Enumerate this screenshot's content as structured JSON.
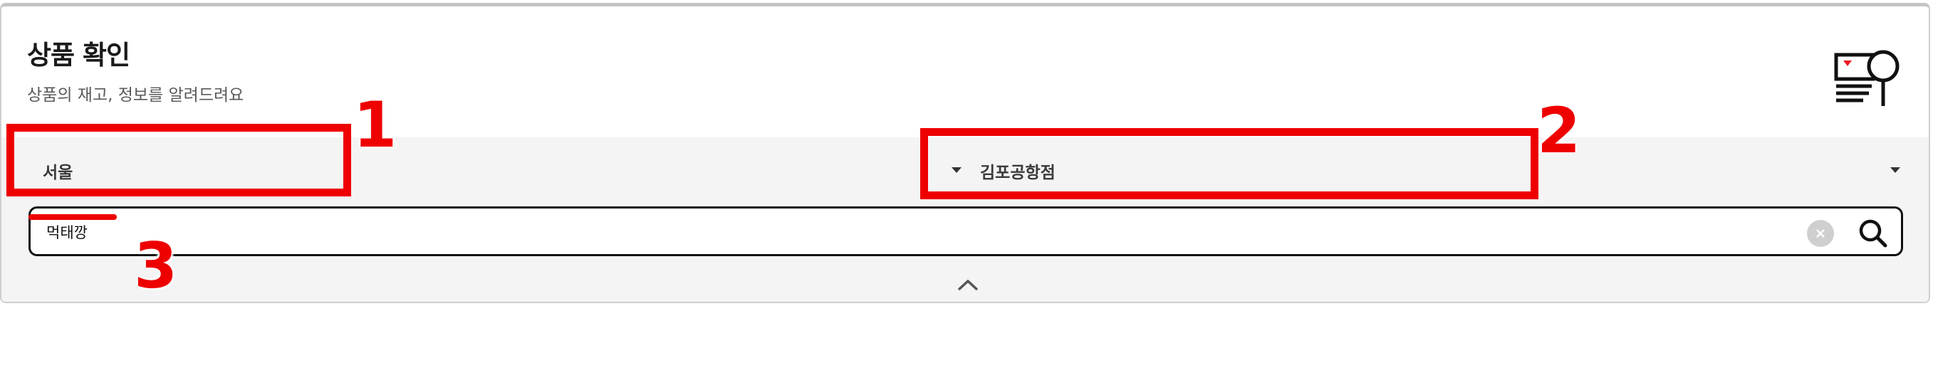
{
  "header": {
    "title": "상품 확인",
    "subtitle": "상품의 재고, 정보를 알려드려요"
  },
  "filters": {
    "region": "서울",
    "branch": "김포공항점"
  },
  "search": {
    "value": "먹태깡"
  },
  "annotations": {
    "label_1": "1",
    "label_2": "2",
    "label_3": "3",
    "color": "#ee0000"
  },
  "icons": {
    "header": "stock-search-icon",
    "clear": "clear-icon",
    "search": "search-icon",
    "collapse": "chevron-up-icon"
  }
}
